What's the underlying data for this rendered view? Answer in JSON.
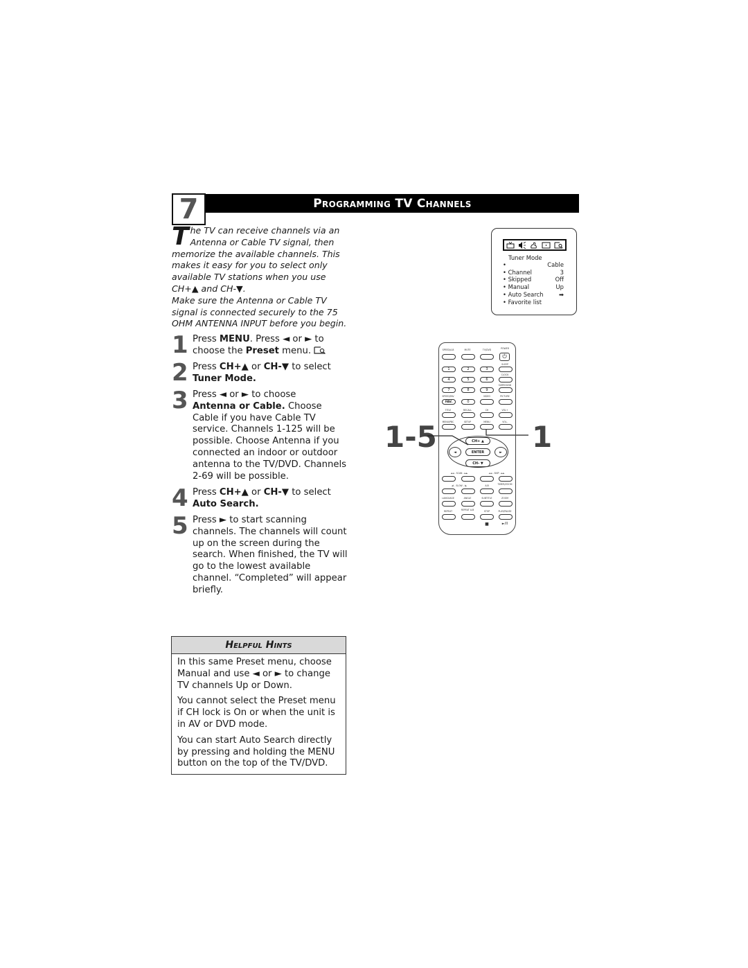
{
  "header": {
    "section_number": "7",
    "title": "Programming TV Channels"
  },
  "intro": {
    "dropcap": "T",
    "paragraph1": "he TV can receive channels via an Antenna or Cable TV signal, then memorize the available channels. This makes it easy for you to select only available TV stations when you use CH+▲ and CH-▼.",
    "paragraph2": "Make sure the Antenna or Cable TV signal is connected securely to the 75 OHM ANTENNA INPUT before you begin."
  },
  "steps": [
    {
      "number": "1",
      "t1": "Press ",
      "b1": "MENU",
      "t2": ". Press ◄ or ► to choose the ",
      "b2": "Preset",
      "t3": " menu. ",
      "icon": "preset-menu-icon"
    },
    {
      "number": "2",
      "t1": "Press ",
      "b1": "CH+▲",
      "t2": " or ",
      "b2": "CH-▼",
      "t3": " to select ",
      "b3": "Tuner Mode."
    },
    {
      "number": "3",
      "t1": "Press ◄ or ► to choose ",
      "b1": "Antenna or Cable.",
      "t2": "  Choose Cable if you have Cable TV service. Channels 1-125 will be possible. Choose Antenna if you connected an indoor or outdoor antenna to the TV/DVD. Channels 2-69 will be possible."
    },
    {
      "number": "4",
      "t1": "Press ",
      "b1": "CH+▲",
      "t2": " or ",
      "b2": "CH-▼",
      "t3": " to select ",
      "b3": "Auto Search."
    },
    {
      "number": "5",
      "t1": "Press ► to start scanning channels. The channels will count up on the screen during the search. When finished, the TV will go to the lowest available channel. “Completed” will appear briefly."
    }
  ],
  "osd_menu": {
    "icons": [
      "tv-icon",
      "speaker-icon",
      "settings-hand-icon",
      "screen-icon",
      "preset-icon"
    ],
    "title": "Tuner Mode",
    "rows": [
      {
        "label": "",
        "value": "Cable"
      },
      {
        "label": "Channel",
        "value": "3"
      },
      {
        "label": "Skipped",
        "value": "Off"
      },
      {
        "label": "Manual",
        "value": "Up"
      },
      {
        "label": "Auto Search",
        "value": "➡"
      },
      {
        "label": "Favorite list",
        "value": ""
      }
    ]
  },
  "remote": {
    "row1_labels": [
      "SPEED/A-B",
      "MUTE",
      "TV/DVD",
      "POWER"
    ],
    "power_glyph": "⏻",
    "side_labels": [
      "SLEEP",
      "CLOCK",
      "SURROUND",
      "PICTURE"
    ],
    "digits": [
      "1",
      "2",
      "3",
      "4",
      "5",
      "6",
      "7",
      "8",
      "9",
      "FAV.",
      "0"
    ],
    "row_fav_labels": [
      "SPEED/FAV",
      "",
      "VIDEO",
      "PICTURE"
    ],
    "row_title_labels": [
      "TITLE",
      "RECALL",
      "CH",
      "VOL+"
    ],
    "row_menu_labels": [
      "MENU/PBC",
      "SETUP",
      "MENU",
      "VOL-"
    ],
    "pad": {
      "up": "CH+ ▲",
      "down": "CH- ▼",
      "center": "ENTER",
      "left": "◄",
      "right": "►"
    },
    "row_skip_labels": [
      "◄◄ - SCAN - ►►",
      "",
      "◄◄ - SKIP - ►►",
      ""
    ],
    "row_slow_labels": [
      "◄I - SLOW - I►",
      "",
      "A-B",
      "TIMER/ZOOM"
    ],
    "row_lang_labels": [
      "LANGUAGE",
      "ANGLE",
      "SUBTITLE",
      "ZOOM"
    ],
    "row_repeat_labels": [
      "REPEAT",
      "REPEAT A-B",
      "STOP",
      "PLAY/PAUSE"
    ],
    "bottom_glyphs": [
      "■",
      "►/II"
    ]
  },
  "callouts": {
    "left": "1-5",
    "right": "1"
  },
  "hints": {
    "title": "Helpful Hints",
    "items": [
      "In this same Preset menu, choose Manual and use ◄ or ► to change TV channels Up or Down.",
      "You cannot select the Preset menu if CH lock is On or when the unit is in AV or DVD mode.",
      "You can start Auto Search directly by pressing and holding the MENU button on the top of the TV/DVD."
    ]
  }
}
